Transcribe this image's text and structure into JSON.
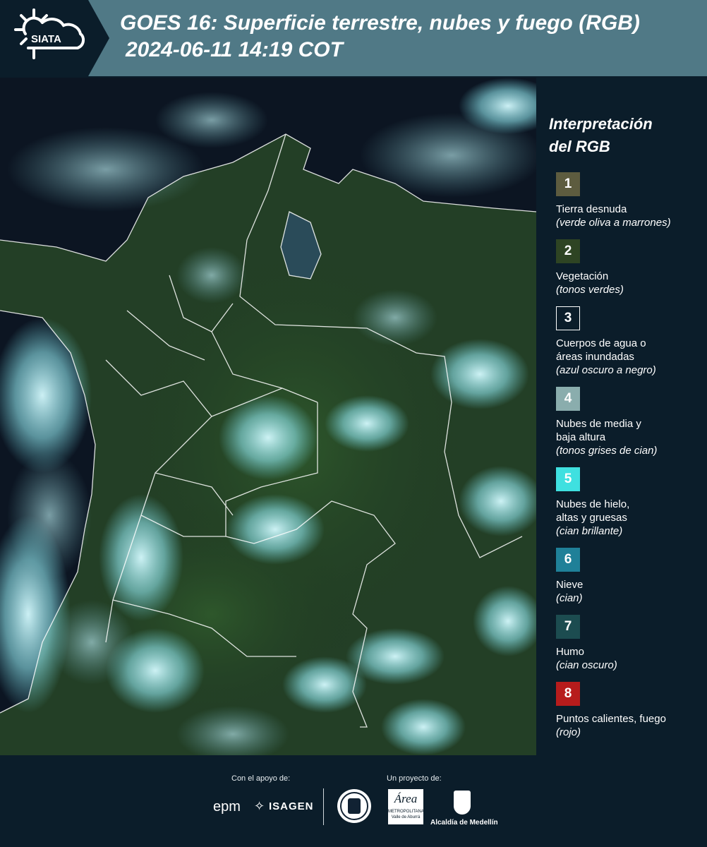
{
  "header": {
    "logo_text": "SIATA",
    "title_line1": "GOES 16: Superficie terrestre, nubes y fuego (RGB)",
    "title_line2": "2024-06-11 14:19 COT"
  },
  "legend": {
    "title_line1": "Interpretación",
    "title_line2": "del RGB",
    "items": [
      {
        "num": "1",
        "color": "#5d5c3f",
        "label1": "Tierra desnuda",
        "label2": "",
        "sub": "(verde oliva a marrones)"
      },
      {
        "num": "2",
        "color": "#2e4423",
        "label1": "Vegetación",
        "label2": "",
        "sub": "(tonos verdes)"
      },
      {
        "num": "3",
        "color": "#0b1d2a",
        "label1": "Cuerpos de agua o",
        "label2": "áreas inundadas",
        "sub": "(azul oscuro a negro)"
      },
      {
        "num": "4",
        "color": "#8aadad",
        "label1": "Nubes de media y",
        "label2": "baja altura",
        "sub": "(tonos grises de cian)"
      },
      {
        "num": "5",
        "color": "#3fe0e0",
        "label1": "Nubes de hielo,",
        "label2": "altas y gruesas",
        "sub": "(cian brillante)"
      },
      {
        "num": "6",
        "color": "#1f8098",
        "label1": "Nieve",
        "label2": "",
        "sub": "(cian)"
      },
      {
        "num": "7",
        "color": "#1c4c50",
        "label1": "Humo",
        "label2": "",
        "sub": "(cian oscuro)"
      },
      {
        "num": "8",
        "color": "#b71c1c",
        "label1": "Puntos calientes, fuego",
        "label2": "",
        "sub": "(rojo)"
      }
    ]
  },
  "footer": {
    "support_label": "Con el apoyo de:",
    "project_label": "Un proyecto de:",
    "sponsor1": "epm",
    "sponsor2": "ISAGEN",
    "partner_area_line1": "METROPOLITANA",
    "partner_area_line2": "Valle de Aburrá",
    "partner_alcaldia": "Alcaldía de Medellín",
    "partner_area_script": "Área"
  }
}
